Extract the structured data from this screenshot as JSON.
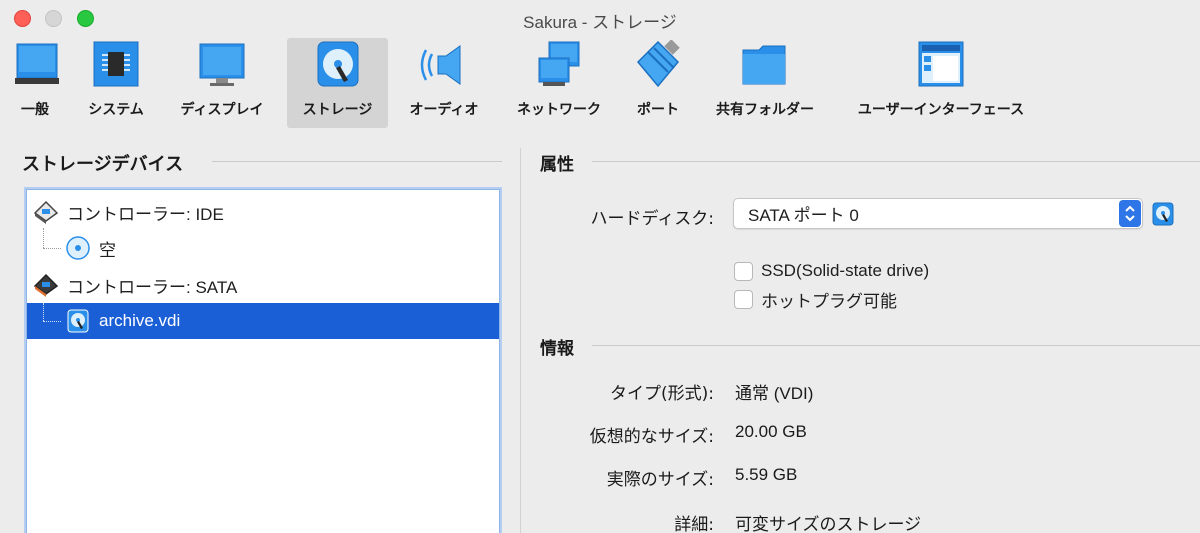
{
  "window": {
    "title": "Sakura - ストレージ"
  },
  "toolbar": {
    "items": [
      {
        "label": "一般",
        "icon": "general-icon"
      },
      {
        "label": "システム",
        "icon": "system-chip-icon"
      },
      {
        "label": "ディスプレイ",
        "icon": "display-monitor-icon"
      },
      {
        "label": "ストレージ",
        "icon": "storage-disk-icon",
        "active": true
      },
      {
        "label": "オーディオ",
        "icon": "audio-speaker-icon"
      },
      {
        "label": "ネットワーク",
        "icon": "network-icon"
      },
      {
        "label": "ポート",
        "icon": "port-plug-icon"
      },
      {
        "label": "共有フォルダー",
        "icon": "shared-folder-icon"
      },
      {
        "label": "ユーザーインターフェース",
        "icon": "user-interface-icon"
      }
    ]
  },
  "left": {
    "section_title": "ストレージデバイス",
    "tree": [
      {
        "label": "コントローラー: IDE",
        "type": "controller"
      },
      {
        "label": "空",
        "type": "optical"
      },
      {
        "label": "コントローラー: SATA",
        "type": "controller"
      },
      {
        "label": "archive.vdi",
        "type": "disk",
        "selected": true
      }
    ]
  },
  "attributes": {
    "section_title": "属性",
    "harddisk_label": "ハードディスク:",
    "harddisk_value": "SATA ポート 0",
    "ssd_label": "SSD(Solid-state drive)",
    "hotplug_label": "ホットプラグ可能"
  },
  "info": {
    "section_title": "情報",
    "rows": [
      {
        "label": "タイプ(形式):",
        "value": "通常 (VDI)"
      },
      {
        "label": "仮想的なサイズ:",
        "value": "20.00 GB"
      },
      {
        "label": "実際のサイズ:",
        "value": "5.59 GB"
      },
      {
        "label": "詳細:",
        "value": "可変サイズのストレージ"
      }
    ]
  },
  "colors": {
    "accent": "#1a5fd6",
    "icon_blue": "#2a8fe8",
    "close": "#fe5f57",
    "maximize": "#28c840"
  }
}
